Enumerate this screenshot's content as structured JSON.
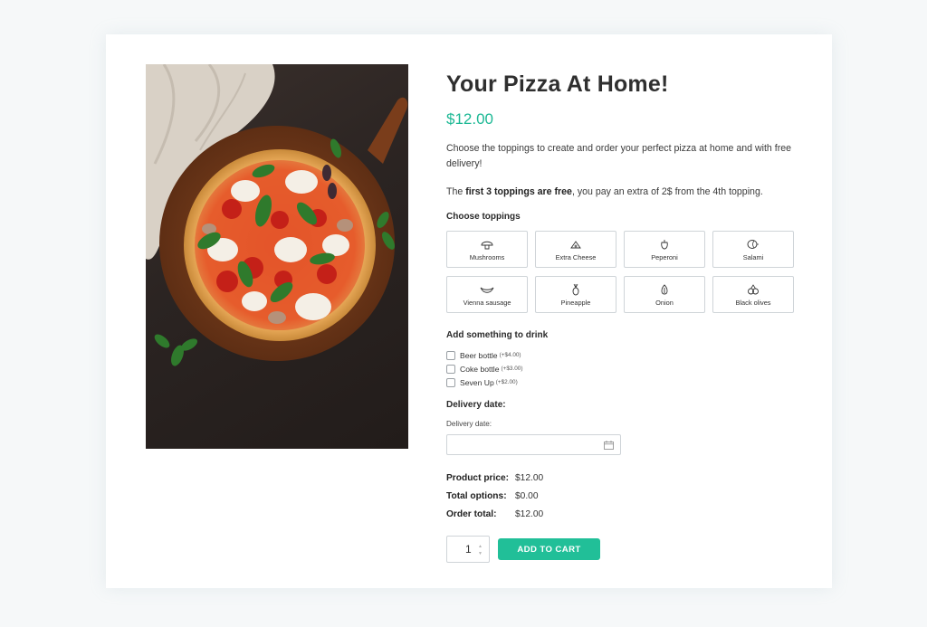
{
  "product": {
    "title": "Your Pizza At Home!",
    "price": "$12.00",
    "description": "Choose the toppings to create and order your perfect pizza at home and with free delivery!",
    "note_prefix": "The ",
    "note_bold": "first 3 toppings are free",
    "note_suffix": ", you pay an extra of 2$ from the 4th topping."
  },
  "toppings": {
    "label": "Choose toppings",
    "items": [
      {
        "label": "Mushrooms",
        "icon": "mushroom-icon"
      },
      {
        "label": "Extra Cheese",
        "icon": "cheese-icon"
      },
      {
        "label": "Peperoni",
        "icon": "pepper-icon"
      },
      {
        "label": "Salami",
        "icon": "salami-icon"
      },
      {
        "label": "Vienna sausage",
        "icon": "sausage-icon"
      },
      {
        "label": "Pineapple",
        "icon": "pineapple-icon"
      },
      {
        "label": "Onion",
        "icon": "onion-icon"
      },
      {
        "label": "Black olives",
        "icon": "olives-icon"
      }
    ]
  },
  "drinks": {
    "label": "Add something to drink",
    "items": [
      {
        "label": "Beer bottle",
        "extra": "(+$4.00)"
      },
      {
        "label": "Coke bottle",
        "extra": "(+$3.00)"
      },
      {
        "label": "Seven Up",
        "extra": "(+$2.00)"
      }
    ]
  },
  "delivery": {
    "label": "Delivery date:",
    "field_label": "Delivery date:",
    "value": ""
  },
  "totals": {
    "product_price_label": "Product price:",
    "product_price": "$12.00",
    "total_options_label": "Total options:",
    "total_options": "$0.00",
    "order_total_label": "Order total:",
    "order_total": "$12.00"
  },
  "cart": {
    "quantity": "1",
    "button_label": "ADD TO CART"
  },
  "colors": {
    "accent": "#21bf98",
    "price": "#1cb894"
  }
}
